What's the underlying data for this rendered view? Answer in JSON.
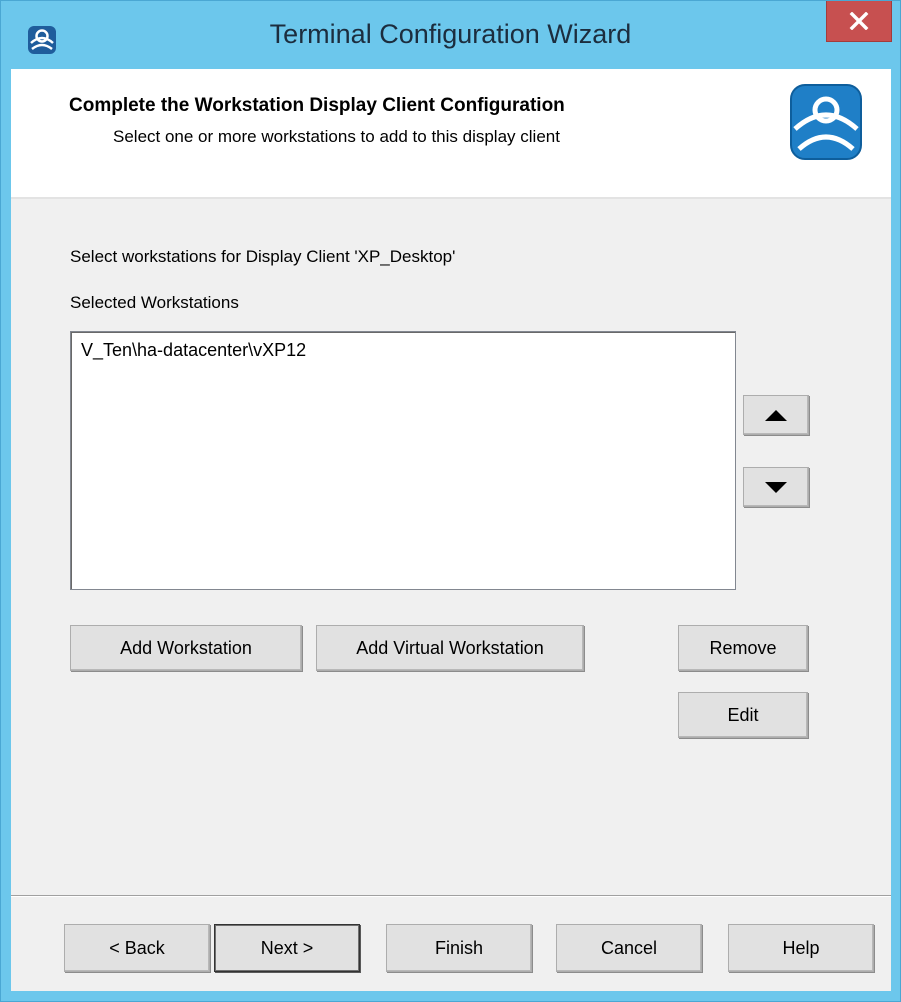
{
  "window": {
    "title": "Terminal Configuration Wizard"
  },
  "header": {
    "title": "Complete the Workstation Display Client Configuration",
    "subtitle": "Select one or more workstations to add to this display client"
  },
  "main": {
    "instruction": "Select workstations for Display Client 'XP_Desktop'",
    "list_label": "Selected Workstations",
    "workstations": [
      "V_Ten\\ha-datacenter\\vXP12"
    ],
    "add_workstation_label": "Add Workstation",
    "add_virtual_label": "Add Virtual Workstation",
    "remove_label": "Remove",
    "edit_label": "Edit"
  },
  "footer": {
    "back_label": "< Back",
    "next_label": "Next >",
    "finish_label": "Finish",
    "cancel_label": "Cancel",
    "help_label": "Help"
  },
  "colors": {
    "title_bar": "#6cc7ec",
    "close_button": "#c75050",
    "logo_blue": "#1f7fc7"
  },
  "icons": {
    "app_icon": "thinmanager-icon",
    "close_icon": "close-icon",
    "header_logo": "thinmanager-logo",
    "move_up": "triangle-up-icon",
    "move_down": "triangle-down-icon"
  }
}
